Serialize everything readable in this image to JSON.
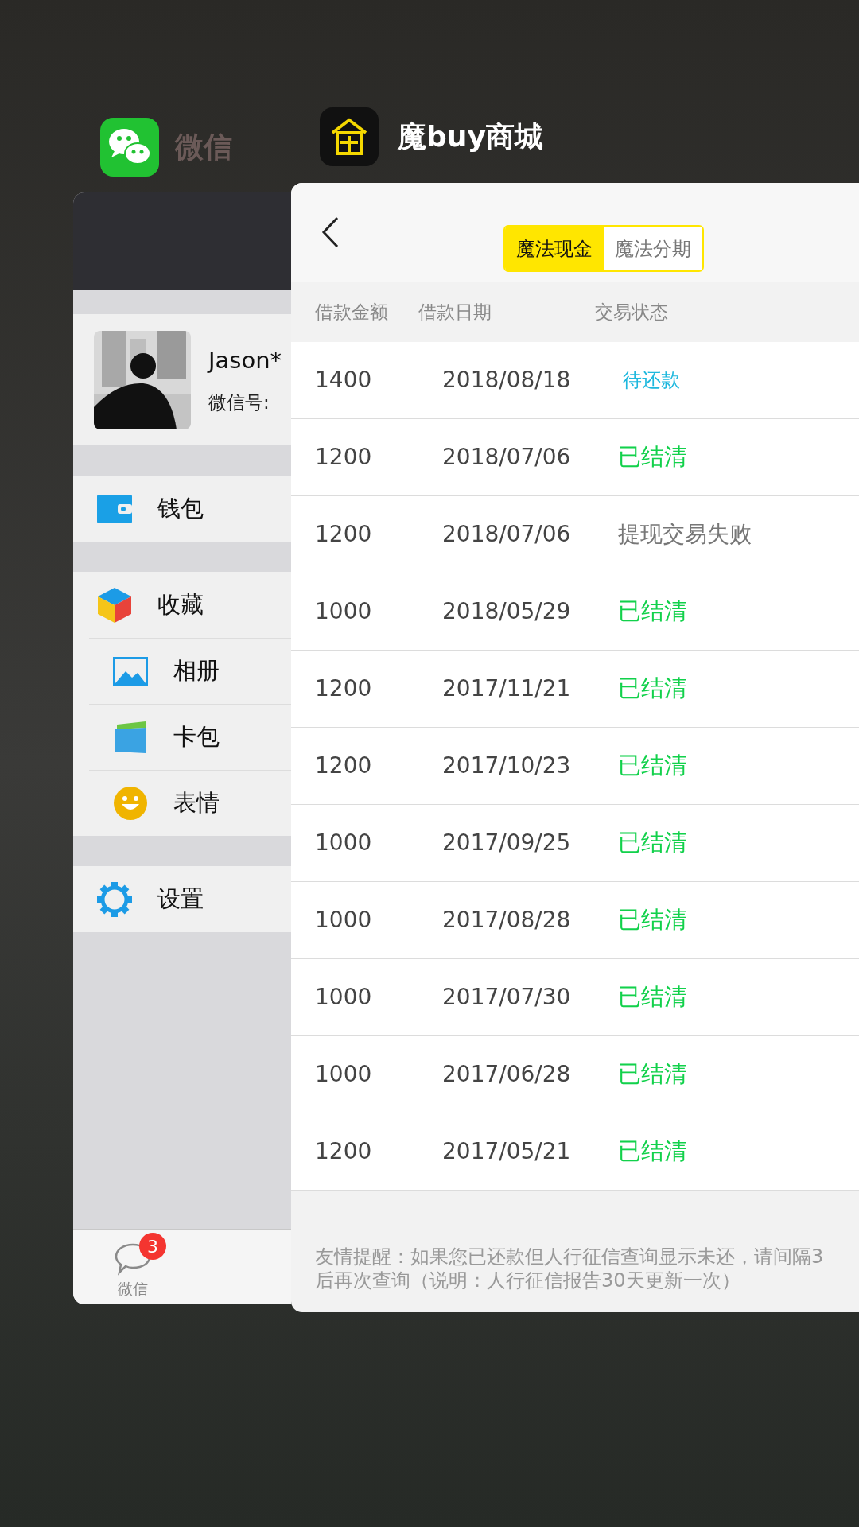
{
  "wechat": {
    "app_label": "微信",
    "profile": {
      "name": "Jason*",
      "id_label": "微信号:"
    },
    "menu_groups": [
      [
        {
          "label": "钱包",
          "kind": "wallet"
        }
      ],
      [
        {
          "label": "收藏",
          "kind": "favorites"
        },
        {
          "label": "相册",
          "kind": "album"
        },
        {
          "label": "卡包",
          "kind": "cards"
        },
        {
          "label": "表情",
          "kind": "stickers"
        }
      ],
      [
        {
          "label": "设置",
          "kind": "settings"
        }
      ]
    ],
    "tab_bar": [
      {
        "label": "微信",
        "badge": "3"
      }
    ]
  },
  "mobuy": {
    "app_label": "魔buy商城",
    "tabs": [
      {
        "label": "魔法现金",
        "selected": true
      },
      {
        "label": "魔法分期",
        "selected": false
      }
    ],
    "columns": [
      "借款金额",
      "借款日期",
      "交易状态"
    ],
    "rows": [
      {
        "amount": "1400",
        "date": "2018/08/18",
        "status": "待还款",
        "kind": "pending"
      },
      {
        "amount": "1200",
        "date": "2018/07/06",
        "status": "已结清",
        "kind": "settled"
      },
      {
        "amount": "1200",
        "date": "2018/07/06",
        "status": "提现交易失败",
        "kind": "failed"
      },
      {
        "amount": "1000",
        "date": "2018/05/29",
        "status": "已结清",
        "kind": "settled"
      },
      {
        "amount": "1200",
        "date": "2017/11/21",
        "status": "已结清",
        "kind": "settled"
      },
      {
        "amount": "1200",
        "date": "2017/10/23",
        "status": "已结清",
        "kind": "settled"
      },
      {
        "amount": "1000",
        "date": "2017/09/25",
        "status": "已结清",
        "kind": "settled"
      },
      {
        "amount": "1000",
        "date": "2017/08/28",
        "status": "已结清",
        "kind": "settled"
      },
      {
        "amount": "1000",
        "date": "2017/07/30",
        "status": "已结清",
        "kind": "settled"
      },
      {
        "amount": "1000",
        "date": "2017/06/28",
        "status": "已结清",
        "kind": "settled"
      },
      {
        "amount": "1200",
        "date": "2017/05/21",
        "status": "已结清",
        "kind": "settled"
      }
    ],
    "tip_lines": [
      "友情提醒：如果您已还款但人行征信查询显示未还，请间隔3",
      "后再次查询（说明：人行征信报告30天更新一次）"
    ]
  }
}
